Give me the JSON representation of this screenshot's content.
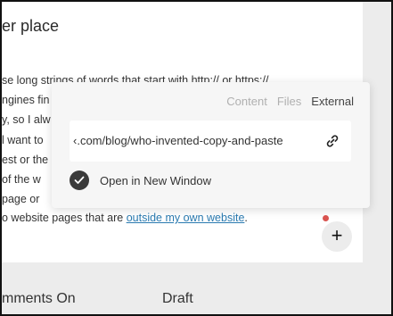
{
  "editor": {
    "heading": "er place",
    "lines": [
      "se long strings of words that start with http:// or https://",
      "ngines fin",
      "y, so I alw",
      "l want to",
      "est or the",
      "of the w",
      "page or",
      "o website pages that are "
    ],
    "link_text": "outside my own website",
    "after_link": "."
  },
  "link_popover": {
    "tabs": [
      "Content",
      "Files",
      "External"
    ],
    "active_tab": "External",
    "url_value": "‹.com/blog/who-invented-copy-and-paste",
    "open_new_window_label": "Open in New Window",
    "open_new_window_checked": true
  },
  "add_button_label": "+",
  "footer": {
    "comments_label": "mments On",
    "status_label": "Draft"
  },
  "colors": {
    "link": "#2a7ab0",
    "notification_dot": "#d9534f"
  }
}
